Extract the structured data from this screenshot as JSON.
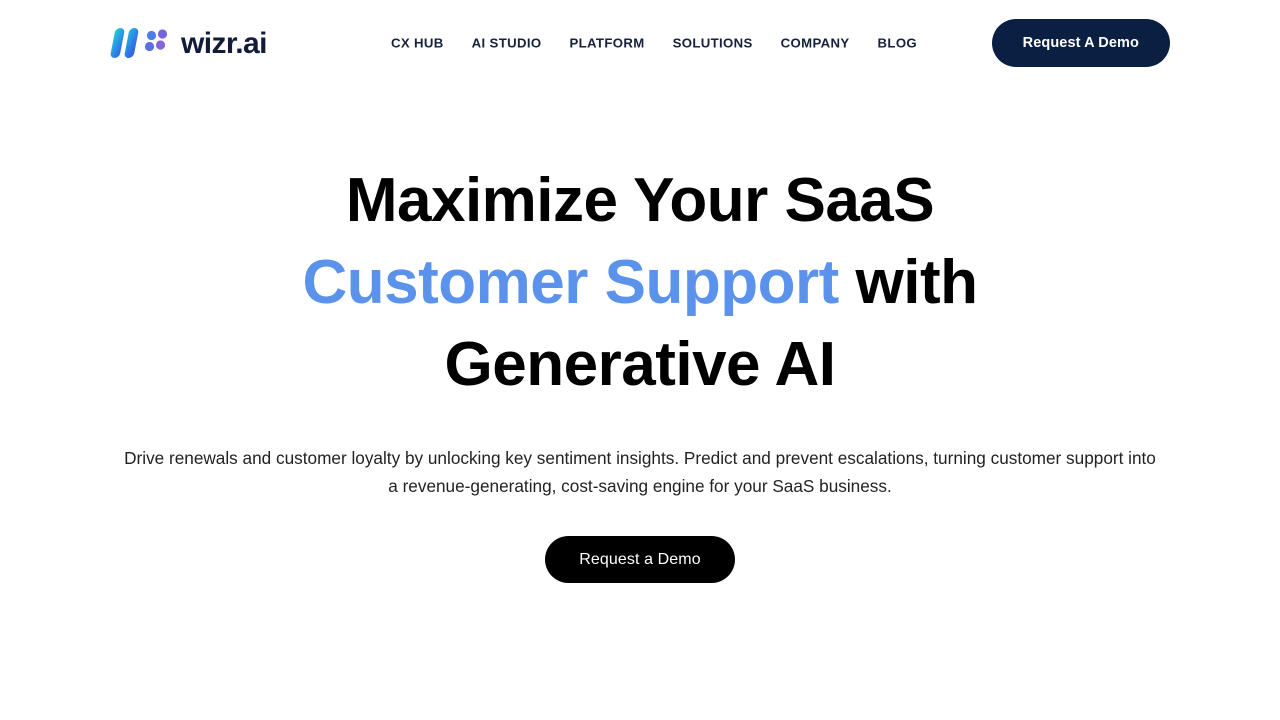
{
  "brand": {
    "wordmark": "wizr.ai",
    "logo_icon": "wizr-logo-mark",
    "colors": {
      "bar_gradient_start": "#18d6cf",
      "bar_gradient_end": "#2f6fe4",
      "dots": "#6f5fd8",
      "wordmark": "#111c3a"
    }
  },
  "nav": {
    "items": [
      {
        "label": "Cx HUB",
        "name": "nav-item-cx-hub"
      },
      {
        "label": "AI STUDIO",
        "name": "nav-item-ai-studio"
      },
      {
        "label": "PLATFORM",
        "name": "nav-item-platform"
      },
      {
        "label": "SOLUTIONS",
        "name": "nav-item-solutions"
      },
      {
        "label": "COMPANY",
        "name": "nav-item-company"
      },
      {
        "label": "BLOG",
        "name": "nav-item-blog"
      }
    ]
  },
  "header": {
    "cta_label": "Request A Demo",
    "cta_color": "#0b1f42"
  },
  "hero": {
    "headline_line1": "Maximize Your SaaS",
    "headline_line2_accent": "Customer Support",
    "headline_line2_rest": " with",
    "headline_line3": "Generative AI",
    "accent_color": "#5b92ec",
    "subhead": "Drive renewals and customer loyalty by unlocking key sentiment insights. Predict and prevent escalations, turning customer support into a revenue-generating, cost-saving engine for your SaaS business.",
    "cta_label": "Request a Demo",
    "cta_color": "#000000"
  }
}
